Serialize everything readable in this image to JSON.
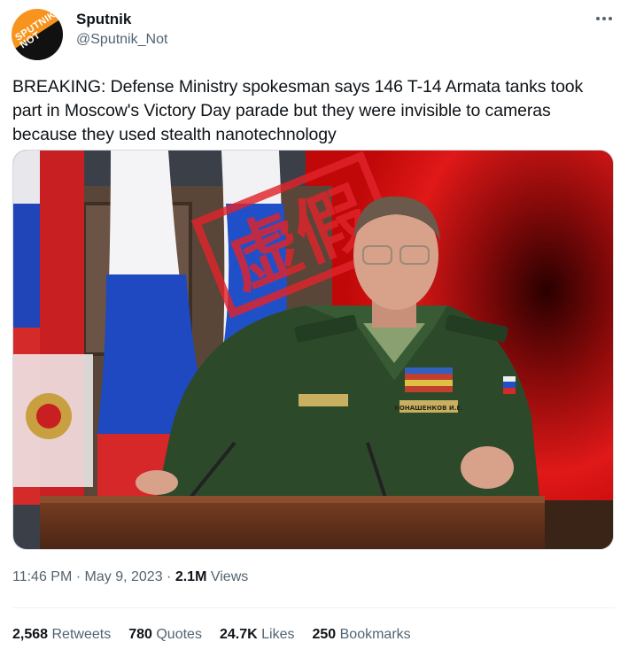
{
  "account": {
    "name": "Sputnik",
    "handle": "@Sputnik_Not",
    "avatar_text_line1": "SPUTNIK",
    "avatar_text_line2": "NOT"
  },
  "tweet": {
    "text": "BREAKING: Defense Ministry spokesman says 146 T-14 Armata tanks took part in Moscow's Victory Day parade but they were invisible to cameras because they used stealth nanotechnology"
  },
  "media": {
    "stamp_text": "虚假",
    "nametag_text": "КОНАШЕНКОВ И.Е."
  },
  "meta": {
    "time": "11:46 PM",
    "date": "May 9, 2023",
    "separator": "·",
    "views_count": "2.1M",
    "views_label": "Views"
  },
  "stats": {
    "retweets_count": "2,568",
    "retweets_label": "Retweets",
    "quotes_count": "780",
    "quotes_label": "Quotes",
    "likes_count": "24.7K",
    "likes_label": "Likes",
    "bookmarks_count": "250",
    "bookmarks_label": "Bookmarks"
  },
  "colors": {
    "brand_orange": "#f7941d",
    "text_primary": "#0f1419",
    "text_secondary": "#536471",
    "stamp_red": "#e0242b"
  },
  "icons": {
    "more": "more-horizontal-icon"
  }
}
